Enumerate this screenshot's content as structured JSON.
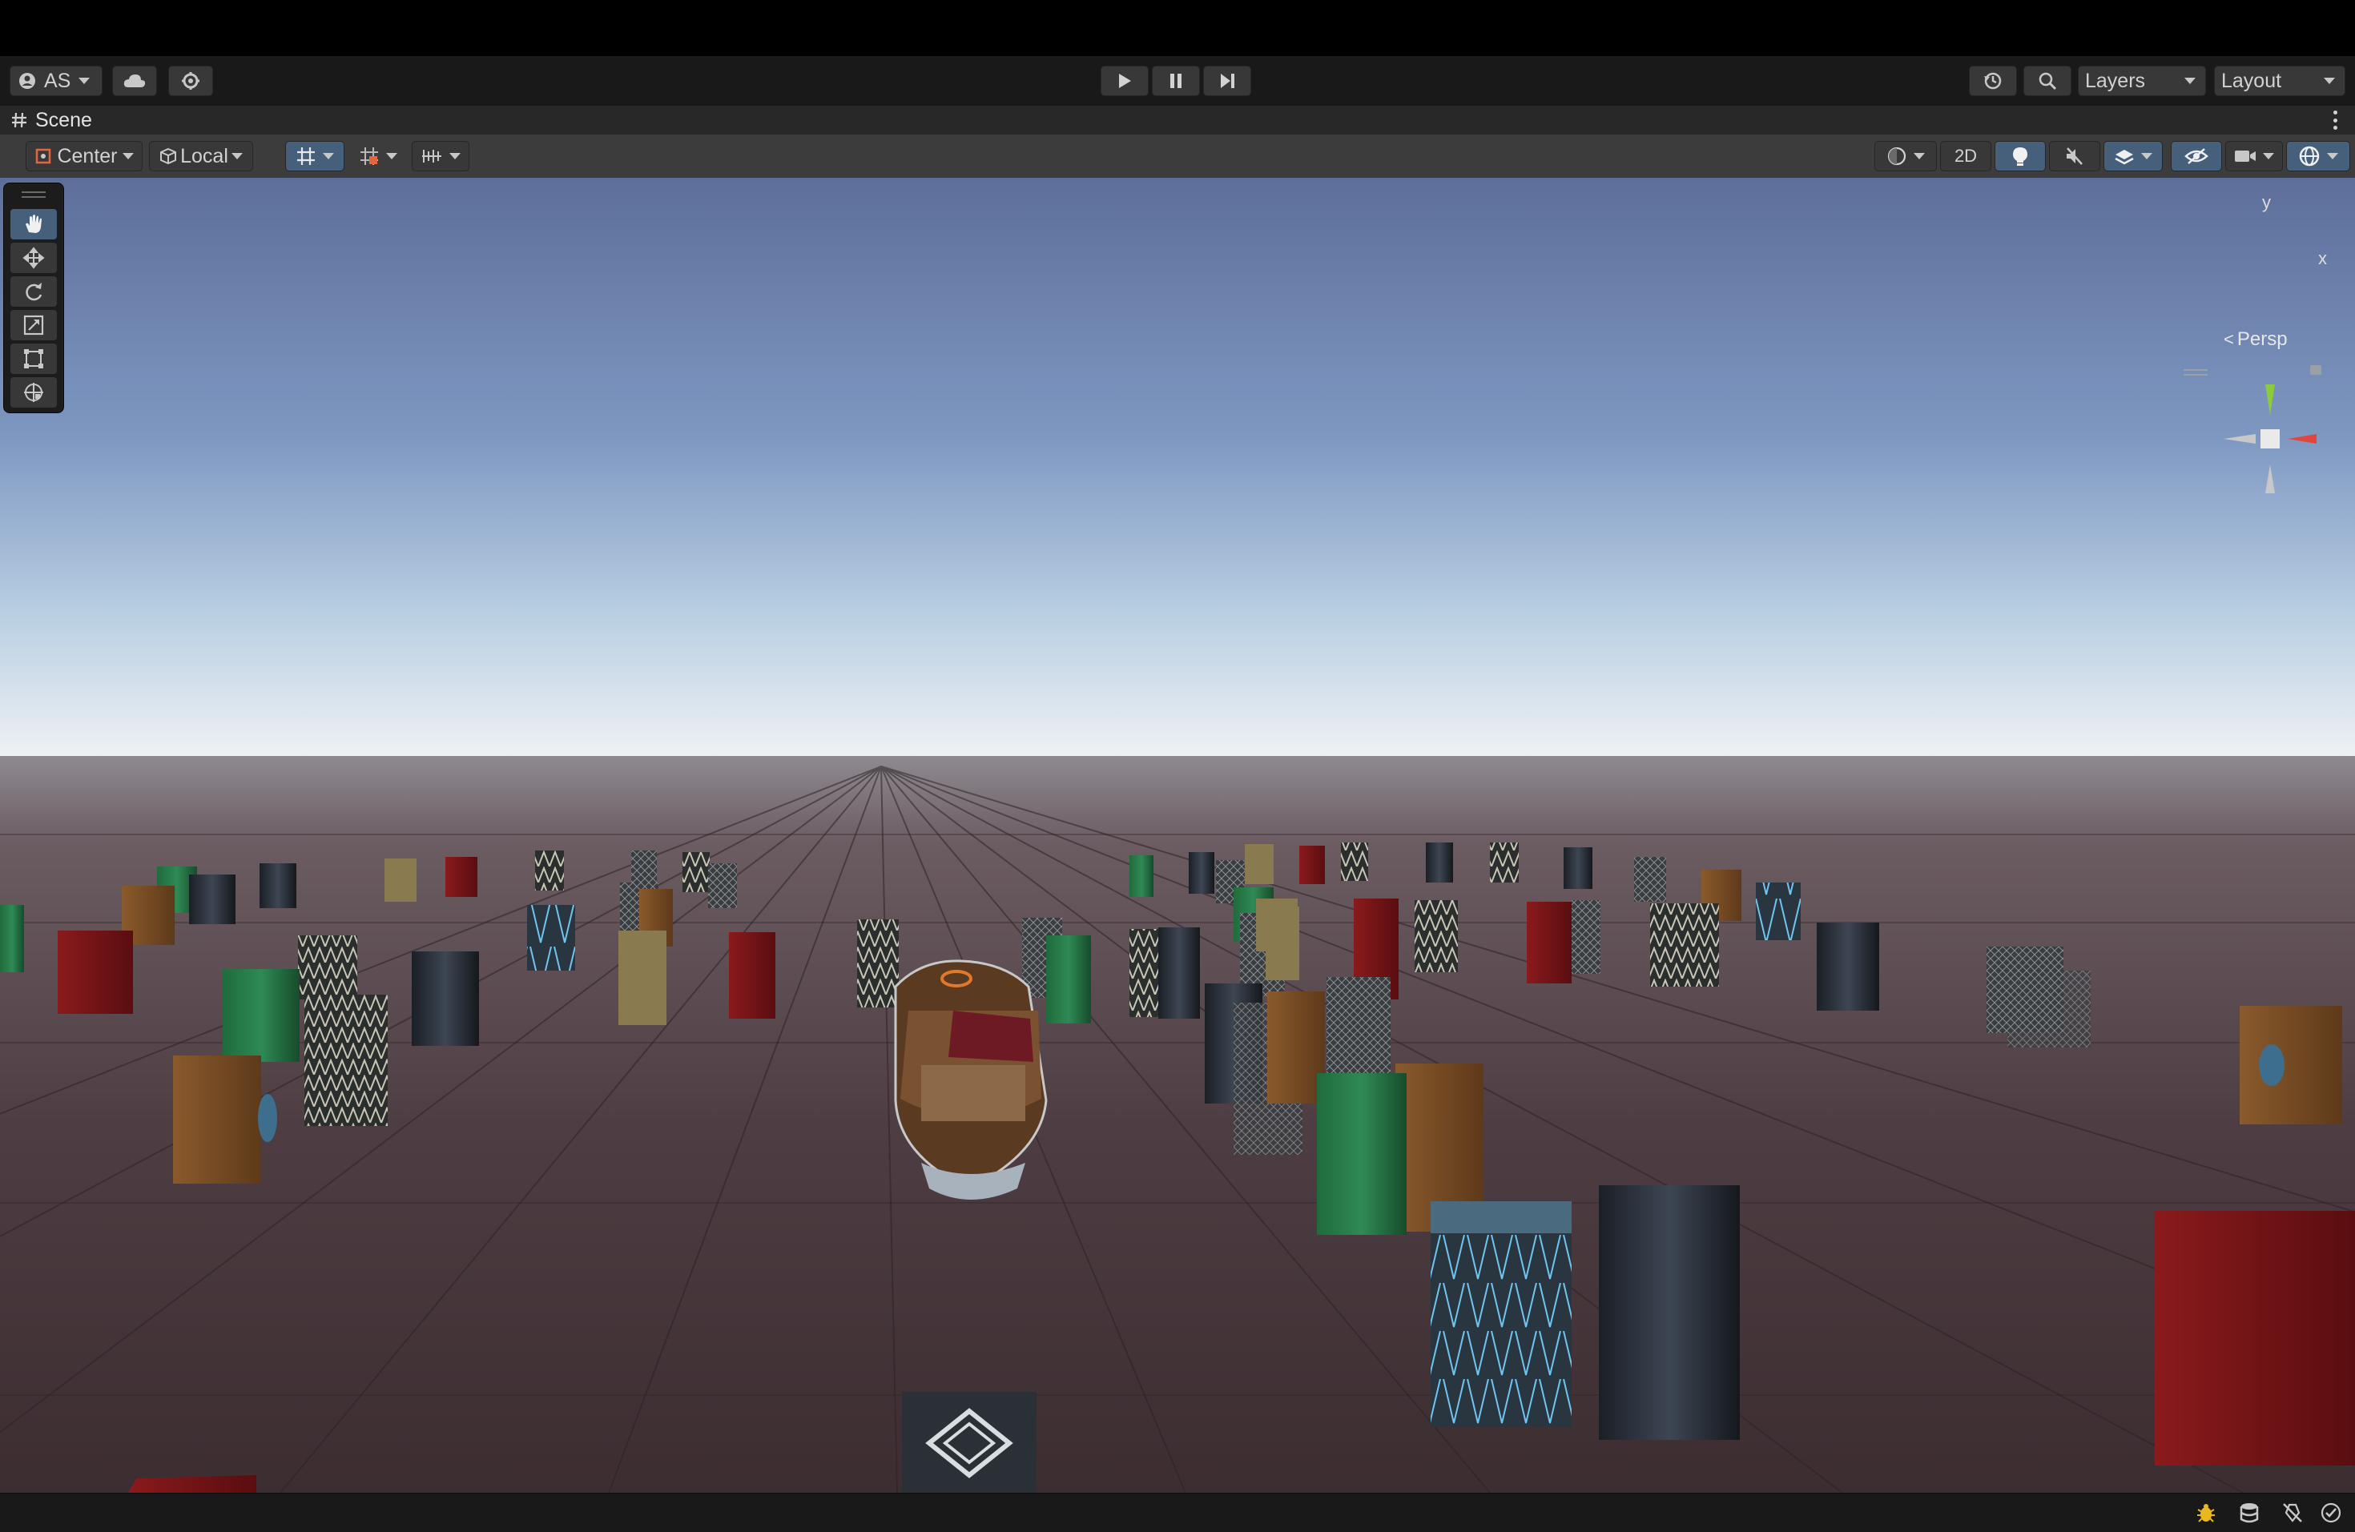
{
  "toolbar": {
    "account_label": "AS",
    "layers_label": "Layers",
    "layout_label": "Layout"
  },
  "scene_tab": {
    "title": "Scene"
  },
  "scene_toolbar": {
    "pivot_label": "Center",
    "space_label": "Local",
    "mode_2d_label": "2D"
  },
  "gizmo": {
    "axis_y": "y",
    "axis_x": "x",
    "projection_label": "Persp"
  },
  "colors": {
    "toolbar_bg": "#191919",
    "scene_toolbar_bg": "#3c3c3c",
    "active_button": "#46607c",
    "sky_top": "#5d6e9a",
    "sky_horizon": "#eef1f3",
    "ground": "#4a3a3f"
  },
  "icons": {
    "account": "account-icon",
    "cloud": "cloud-icon",
    "services": "services-gear-icon",
    "play": "play-icon",
    "pause": "pause-icon",
    "step": "step-icon",
    "history": "undo-history-icon",
    "search": "search-icon",
    "tools": [
      "hand-icon",
      "move-icon",
      "rotate-icon",
      "scale-icon",
      "rect-icon",
      "transform-icon"
    ]
  }
}
